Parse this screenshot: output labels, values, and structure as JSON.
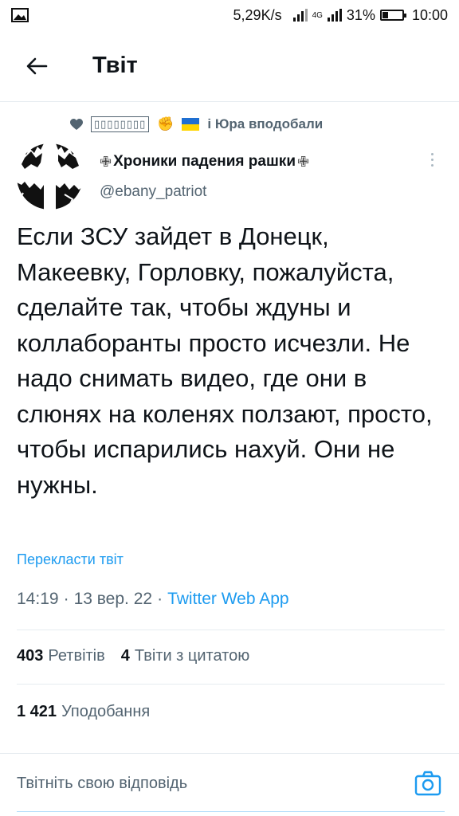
{
  "status_bar": {
    "speed": "5,29K/s",
    "network": "4G",
    "battery": "31%",
    "battery_level": 0.31,
    "time": "10:00"
  },
  "header": {
    "title": "Твіт"
  },
  "liked_by": {
    "names_glyphs": "▯▯▯▯▯▯▯▯",
    "emoji_fist": "✊",
    "emoji_flag": "🇺🇦",
    "suffix": "і Юра вподобали"
  },
  "author": {
    "cross_left": "✙",
    "display_name": "Хроники падения рашки",
    "cross_right": "✙",
    "handle": "@ebany_patriot"
  },
  "tweet": {
    "text": "Если ЗСУ зайдет в Донецк, Макеевку, Горловку, пожалуйста, сделайте так, чтобы ждуны и коллаборанты просто исчезли. Не надо снимать видео, где они в слюнях на коленях ползают, просто, чтобы испарились нахуй. Они не нужны.",
    "translate_label": "Перекласти твіт",
    "time": "14:19",
    "date": "13 вер. 22",
    "app": "Twitter Web App",
    "separator": "·"
  },
  "stats": {
    "retweets_count": "403",
    "retweets_label": "Ретвітів",
    "quotes_count": "4",
    "quotes_label": "Твіти з цитатою",
    "likes_count": "1 421",
    "likes_label": "Уподобання"
  },
  "reply": {
    "placeholder": "Твітніть свою відповідь"
  },
  "colors": {
    "accent": "#1d9bf0",
    "text": "#0f1419",
    "muted": "#536471"
  }
}
